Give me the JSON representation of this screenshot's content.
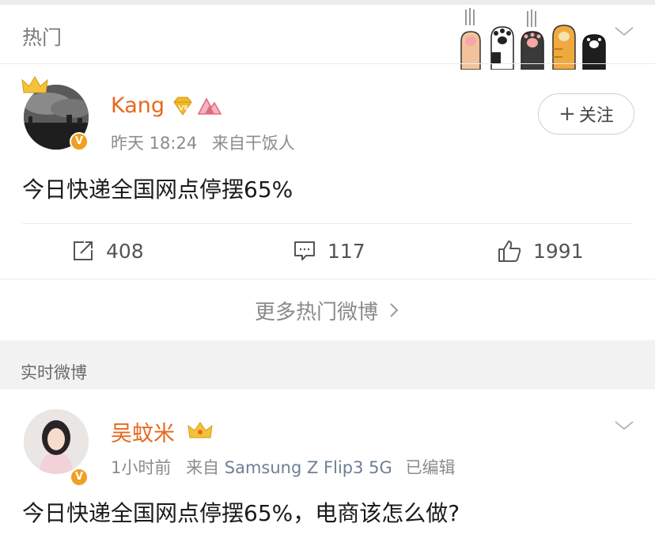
{
  "hot": {
    "title": "热门",
    "post": {
      "username": "Kang",
      "time": "昨天 18:24",
      "source": "来自干饭人",
      "follow_label": "关注",
      "text": "今日快递全国网点停摆65%",
      "reposts": "408",
      "comments": "117",
      "likes": "1991"
    },
    "more_label": "更多热门微博"
  },
  "realtime": {
    "title": "实时微博",
    "post": {
      "username": "吴蚊米",
      "time": "1小时前",
      "source_prefix": "来自",
      "device": "Samsung Z Flip3 5G",
      "edited": "已编辑",
      "text": "今日快递全国网点停摆65%，电商该怎么做?"
    }
  },
  "icons": {
    "verified_badge": "V",
    "verified": "verified-v-icon",
    "vip": "vip-diamond-icon",
    "mountain": "mountain-badge-icon",
    "crown": "crown-icon",
    "repost": "repost-icon",
    "comment": "comment-icon",
    "like": "thumbs-up-icon",
    "chevron": "chevron-down-icon",
    "more_arrow": "chevron-right-icon",
    "paws": "cat-paws-sticker"
  },
  "colors": {
    "username": "#e8681e",
    "badge": "#f0a020",
    "device_link": "#6f7f95",
    "background": "#f2f2f2"
  }
}
